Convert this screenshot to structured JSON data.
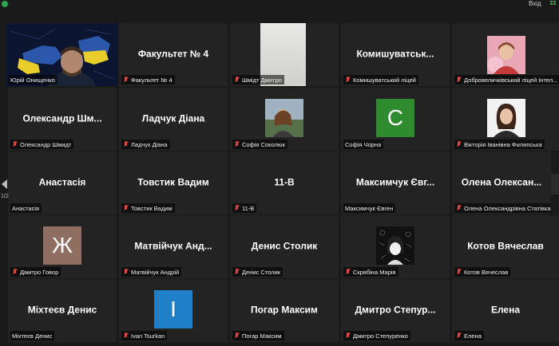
{
  "topbar": {
    "enter_label": "Вхід"
  },
  "pagination": {
    "indicator": "1/2"
  },
  "colors": {
    "active_speaker_border": "#d8d34a",
    "muted_mic": "#e5473d",
    "avatar_zh": "#8e6f62",
    "avatar_s": "#2e8b2e",
    "avatar_i": "#1f7fc7"
  },
  "tiles": [
    {
      "label": "Юрій Онищенко",
      "muted": false,
      "kind": "video"
    },
    {
      "title": "Факультет № 4",
      "label": "Факультет № 4",
      "muted": true
    },
    {
      "label": "Шмідт Дмитро",
      "muted": true,
      "kind": "photo"
    },
    {
      "title": "Комишуватськ...",
      "label": "Комишуватський ліцей",
      "muted": true
    },
    {
      "label": "Добровеличківський ліцей Інтел...",
      "muted": true,
      "kind": "photo"
    },
    {
      "title": "Олександр  Шм...",
      "label": "Олександр Шмидт",
      "muted": true
    },
    {
      "title": "Ладчук Діана",
      "label": "Ладчук Діана",
      "muted": true
    },
    {
      "label": "Софія Соколюк",
      "muted": true,
      "kind": "photo"
    },
    {
      "avatar_letter": "С",
      "label": "Софія Чорна",
      "muted": false
    },
    {
      "label": "Вікторія Іванівна Филипська",
      "muted": true,
      "kind": "photo"
    },
    {
      "title": "Анастасія",
      "label": "Анастасія",
      "muted": false
    },
    {
      "title": "Товстик Вадим",
      "label": "Товстик Вадим",
      "muted": true
    },
    {
      "title": "11-В",
      "label": "11-В",
      "muted": true
    },
    {
      "title": "Максимчук  Євг...",
      "label": "Максимчук Євген",
      "muted": false
    },
    {
      "title": "Олена  Олексан...",
      "label": "Олена Олександрівна Статівка",
      "muted": true
    },
    {
      "avatar_letter": "Ж",
      "label": "Дмитро Говор",
      "muted": true
    },
    {
      "title": "Матвійчук  Анд...",
      "label": "Матвійчук Андрій",
      "muted": true
    },
    {
      "title": "Денис Столик",
      "label": "Денис Столик",
      "muted": true
    },
    {
      "label": "Скрябіна Марія",
      "muted": true,
      "kind": "photo"
    },
    {
      "title": "Котов Вячеслав",
      "label": "Котов Вячеслав",
      "muted": true
    },
    {
      "title": "Міхтеєв Денис",
      "label": "Міхтеєв Денис",
      "muted": false
    },
    {
      "avatar_letter": "I",
      "label": "Ivan Tsurkan",
      "muted": true
    },
    {
      "title": "Погар Максим",
      "label": "Погар Максим",
      "muted": true
    },
    {
      "title": "Дмитро  Степур...",
      "label": "Дмитро Степуренко",
      "muted": true
    },
    {
      "title": "Елена",
      "label": "Елена",
      "muted": true
    }
  ]
}
